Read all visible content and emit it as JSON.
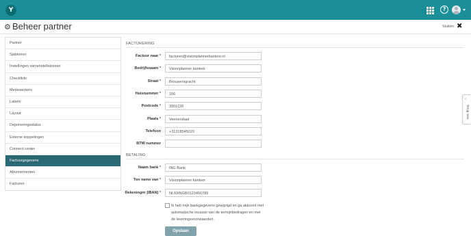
{
  "header": {
    "logo_text": "Y",
    "icons": [
      "apps-grid-icon",
      "help-icon",
      "avatar",
      "chevron-down-icon"
    ],
    "accent_color": "#1a8f97"
  },
  "page": {
    "title": "Beheer partner",
    "close_label": "Sluiten",
    "close_symbol": "✖",
    "settings_icon": "gear-icon"
  },
  "sidebar": {
    "items": [
      {
        "label": "Partner"
      },
      {
        "label": "Sjablonen"
      },
      {
        "label": "Instellingen samenstellalossier"
      },
      {
        "label": "Checklists"
      },
      {
        "label": "Medewerkers"
      },
      {
        "label": "Labels"
      },
      {
        "label": "Layout"
      },
      {
        "label": "Deponeringsstatus"
      },
      {
        "label": "Externe koppelingen"
      },
      {
        "label": "Connect center"
      },
      {
        "label": "Factuurgegevens"
      },
      {
        "label": "Abonnementen"
      },
      {
        "label": "Facturen"
      }
    ],
    "active_item": "Factuurgegevens",
    "active_color": "#2a6873"
  },
  "facturering": {
    "title": "FACTURERING",
    "fields": [
      {
        "label": "Factuur naar",
        "required": "*",
        "value": "facturen@visionplannerkantoor.nl"
      },
      {
        "label": "Bedrijfsnaam",
        "required": "*",
        "value": "Visionplanner kantoor"
      },
      {
        "label": "Straat",
        "required": "*",
        "value": "Brouwersgracht"
      },
      {
        "label": "Huisnummer",
        "required": "*",
        "value": "156"
      },
      {
        "label": "Postcode",
        "required": "*",
        "value": "3901CM"
      },
      {
        "label": "Plaats",
        "required": "*",
        "value": "Veenendaal"
      },
      {
        "label": "Telefoon",
        "required": "",
        "value": "+31318545020"
      },
      {
        "label": "BTW nummer",
        "required": "",
        "value": ""
      }
    ]
  },
  "betaling": {
    "title": "BETALING",
    "fields": [
      {
        "label": "Naam bank",
        "required": "*",
        "value": "ING Bank"
      },
      {
        "label": "Ten name van",
        "required": "*",
        "value": "Visionplanner kantoor"
      },
      {
        "label": "Rekeningnr (IBAN)",
        "required": "*",
        "value": "NL69INGB0123456789"
      }
    ]
  },
  "agreement": {
    "checked": false,
    "text": "Ik heb mijn bankgegevens gewijzigd en ga akkoord met automatische incasso van de termijnbedragen en met de leveringsvoorwaarden."
  },
  "save_label": "Opslaan",
  "side_tab": {
    "label": "Terug naar",
    "chevron": "‹"
  }
}
